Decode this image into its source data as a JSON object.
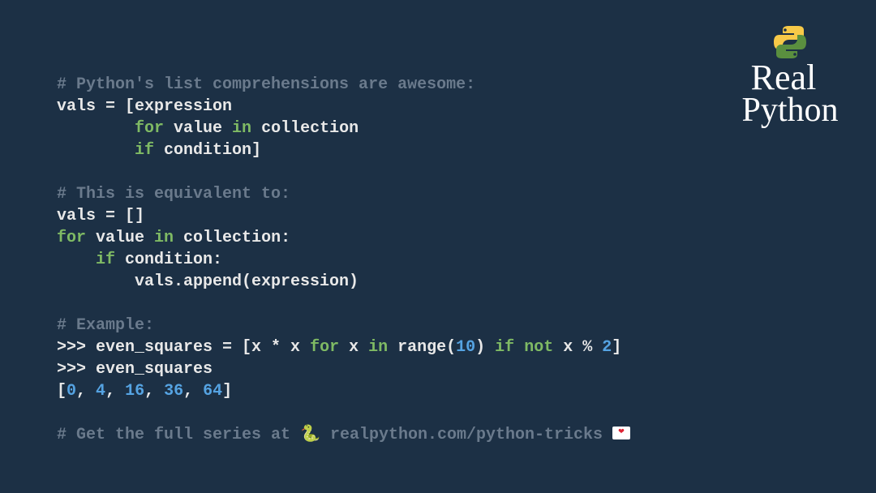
{
  "brand": {
    "line1": "Real",
    "line2": "Python"
  },
  "code": {
    "c1": "# Python's list comprehensions are awesome:",
    "l1_a": "vals = [expression",
    "l2_pad": "        ",
    "l2_for": "for",
    "l2_mid": " value ",
    "l2_in": "in",
    "l2_end": " collection",
    "l3_pad": "        ",
    "l3_if": "if",
    "l3_end": " condition]",
    "blank": "",
    "c2": "# This is equivalent to:",
    "eq1": "vals = []",
    "eq2_for": "for",
    "eq2_mid": " value ",
    "eq2_in": "in",
    "eq2_end": " collection:",
    "eq3_pad": "    ",
    "eq3_if": "if",
    "eq3_end": " condition:",
    "eq4": "        vals.append(expression)",
    "c3": "# Example:",
    "ex1_a": ">>> ",
    "ex1_b": "even_squares = [x * x ",
    "ex1_for": "for",
    "ex1_c": " x ",
    "ex1_in": "in",
    "ex1_d": " range(",
    "ex1_n": "10",
    "ex1_e": ") ",
    "ex1_if": "if",
    "ex1_f": " ",
    "ex1_not": "not",
    "ex1_g": " x % ",
    "ex1_n2": "2",
    "ex1_h": "]",
    "ex2_a": ">>> ",
    "ex2_b": "even_squares",
    "out_open": "[",
    "out_0": "0",
    "out_s": ", ",
    "out_1": "4",
    "out_2": "16",
    "out_3": "36",
    "out_4": "64",
    "out_close": "]",
    "c4a": "# Get the full series at ",
    "c4b": " realpython.com/python-tricks "
  }
}
